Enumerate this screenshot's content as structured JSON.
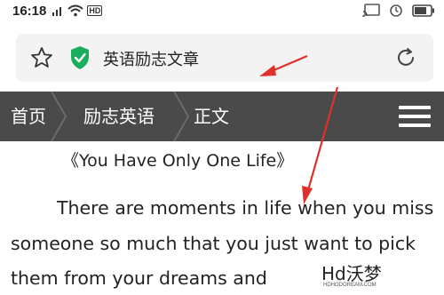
{
  "status_bar": {
    "time": "16:18",
    "hd_badge": "HD",
    "icons": [
      "wifi-icon",
      "signal-icon",
      "cast-icon",
      "alarm-icon",
      "battery-icon"
    ]
  },
  "address_bar": {
    "title": "英语励志文章",
    "icons": [
      "star-icon",
      "shield-check-icon",
      "refresh-icon"
    ],
    "shield_color": "#1aad5b"
  },
  "site_nav": {
    "breadcrumbs": [
      "首页",
      "励志英语",
      "正文"
    ],
    "background": "#4a4a4a",
    "menu_icon": "hamburger-menu-icon"
  },
  "article": {
    "title": "《You Have Only One Life》",
    "lines": [
      "There are moments in life when you miss",
      "someone so much that you just want to pick",
      "them from your dreams and"
    ]
  },
  "annotation_color": "#e0302a",
  "watermark": {
    "logo": "Hd沃梦",
    "sub": "HDHODOREAM.COM"
  }
}
